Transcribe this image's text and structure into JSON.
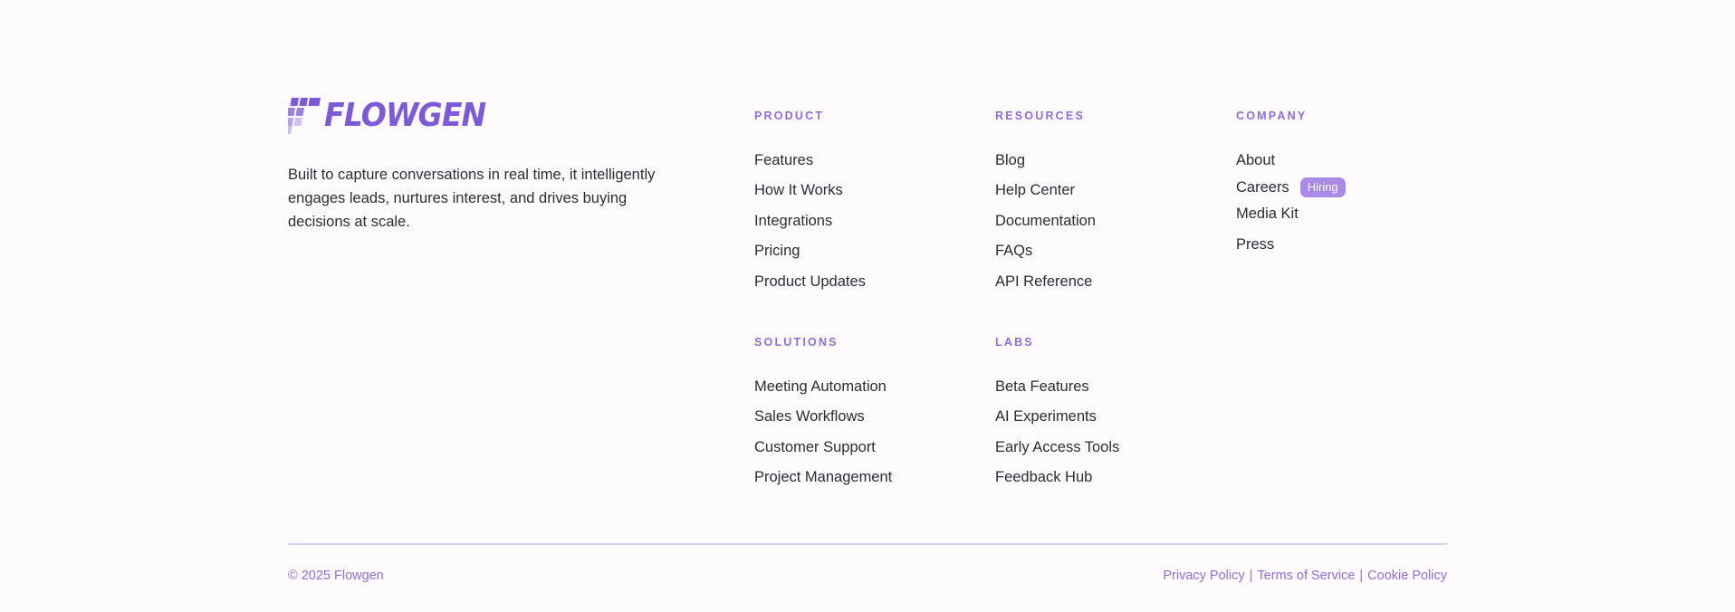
{
  "brand": {
    "name": "FLOWGEN",
    "tagline": "Built to capture conversations in real time, it intelligently engages leads, nurtures interest, and drives buying decisions at scale."
  },
  "columns": {
    "product": {
      "heading": "PRODUCT",
      "links": [
        "Features",
        "How It Works",
        "Integrations",
        "Pricing",
        "Product Updates"
      ]
    },
    "resources": {
      "heading": "RESOURCES",
      "links": [
        "Blog",
        "Help Center",
        "Documentation",
        "FAQs",
        "API Reference"
      ]
    },
    "company": {
      "heading": "COMPANY",
      "links": [
        "About",
        "Careers",
        "Media Kit",
        "Press"
      ],
      "careers_badge": "Hiring"
    },
    "solutions": {
      "heading": "SOLUTIONS",
      "links": [
        "Meeting Automation",
        "Sales Workflows",
        "Customer Support",
        "Project Management"
      ]
    },
    "labs": {
      "heading": "LABS",
      "links": [
        "Beta Features",
        "AI Experiments",
        "Early Access Tools",
        "Feedback Hub"
      ]
    }
  },
  "bottom_bar": {
    "copyright": "© 2025 Flowgen",
    "legal_links": [
      "Privacy Policy",
      "Terms of Service",
      "Cookie Policy"
    ],
    "separator": "|"
  },
  "colors": {
    "accent": "#8f6ddb",
    "logo": "#7c5ad9",
    "badge": "#a98ae8",
    "text": "#2c2c35",
    "divider": "#d8cdf1",
    "background": "#fdfbfb"
  },
  "icons": {
    "logo_mark": "flowgen-logo-icon"
  }
}
